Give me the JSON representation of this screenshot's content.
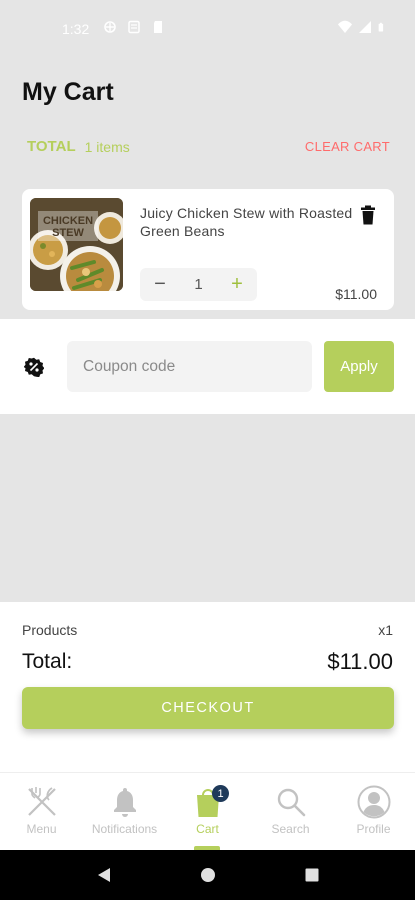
{
  "status_bar": {
    "time": "1:32"
  },
  "header": {
    "title": "My Cart"
  },
  "cart_summary": {
    "total_label": "TOTAL",
    "items_count": "1 items",
    "clear_label": "CLEAR CART"
  },
  "cart_item": {
    "image_caption": "CHICKEN STEW",
    "name": "Juicy Chicken Stew with Roasted Green Beans",
    "quantity": "1",
    "price": "$11.00"
  },
  "coupon": {
    "placeholder": "Coupon code",
    "apply_label": "Apply"
  },
  "summary": {
    "products_label": "Products",
    "products_count": "x1",
    "total_label": "Total:",
    "total_value": "$11.00",
    "checkout_label": "CHECKOUT"
  },
  "nav": {
    "items": [
      {
        "label": "Menu",
        "icon": "fork-knife-icon"
      },
      {
        "label": "Notifications",
        "icon": "bell-icon"
      },
      {
        "label": "Cart",
        "icon": "cart-bag-icon",
        "badge": "1",
        "active": true
      },
      {
        "label": "Search",
        "icon": "search-icon"
      },
      {
        "label": "Profile",
        "icon": "profile-icon"
      }
    ]
  },
  "colors": {
    "accent": "#b5cf5c",
    "danger": "#ff6b6b",
    "badge": "#1f3a5a"
  }
}
